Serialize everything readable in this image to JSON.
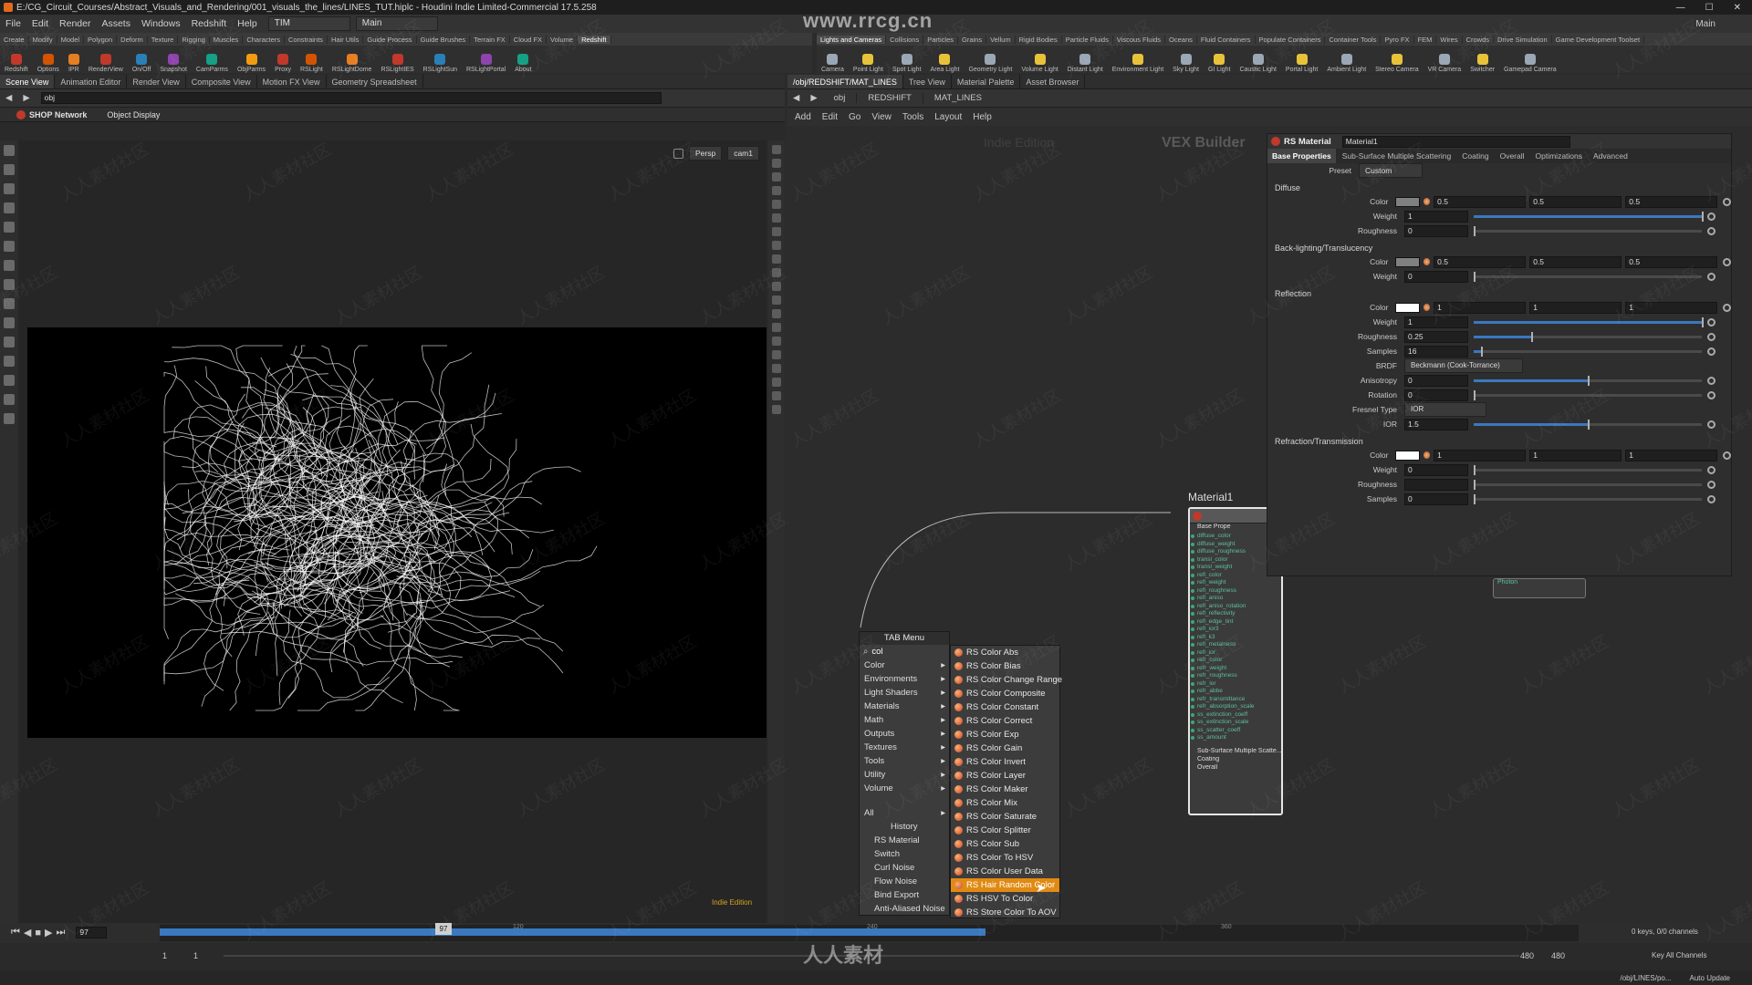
{
  "window": {
    "title": "E:/CG_Circuit_Courses/Abstract_Visuals_and_Rendering/001_visuals_the_lines/LINES_TUT.hiplc - Houdini Indie Limited-Commercial 17.5.258",
    "right_desk": "Main"
  },
  "watermark": {
    "top": "www.rrcg.cn",
    "bottom": "人人素材",
    "tile": "人人素材社区"
  },
  "menubar": {
    "items": [
      "File",
      "Edit",
      "Render",
      "Assets",
      "Windows",
      "Redshift",
      "Help"
    ],
    "desktop": "TIM",
    "main": "Main"
  },
  "left_shelf": {
    "tabs": [
      "Create",
      "Modify",
      "Model",
      "Polygon",
      "Deform",
      "Texture",
      "Rigging",
      "Muscles",
      "Characters",
      "Constraints",
      "Hair Utils",
      "Guide Process",
      "Guide Brushes",
      "Terrain FX",
      "Cloud FX",
      "Volume",
      "Redshift"
    ],
    "active_tab": "Redshift",
    "tools": [
      "Redshift",
      "Options",
      "IPR",
      "RenderView",
      "On/Off",
      "Snapshot",
      "CamParms",
      "ObjParms",
      "Proxy",
      "RSLight",
      "RSLightDome",
      "RSLightIES",
      "RSLightSun",
      "RSLightPortal",
      "About"
    ]
  },
  "right_shelf": {
    "tabs": [
      "Lights and Cameras",
      "Collisions",
      "Particles",
      "Grains",
      "Vellum",
      "Rigid Bodies",
      "Particle Fluids",
      "Viscous Fluids",
      "Oceans",
      "Fluid Containers",
      "Populate Containers",
      "Container Tools",
      "Pyro FX",
      "FEM",
      "Wires",
      "Crowds",
      "Drive Simulation",
      "Game Development Toolset"
    ],
    "active_tab": "Lights and Cameras",
    "tools": [
      "Camera",
      "Point Light",
      "Spot Light",
      "Area Light",
      "Geometry Light",
      "Volume Light",
      "Distant Light",
      "Environment Light",
      "Sky Light",
      "GI Light",
      "Caustic Light",
      "Portal Light",
      "Ambient Light",
      "Stereo Camera",
      "VR Camera",
      "Switcher",
      "Gamepad Camera"
    ]
  },
  "scene_view": {
    "tabs": [
      "Scene View",
      "Animation Editor",
      "Render View",
      "Composite View",
      "Motion FX View",
      "Geometry Spreadsheet"
    ],
    "path": "obj",
    "network_label": "SHOP Network",
    "display_label": "Object Display",
    "persp": "Persp",
    "camera": "cam1",
    "edition": "Indie Edition"
  },
  "network_view": {
    "tabs": [
      "/obj/REDSHIFT/MAT_LINES",
      "Tree View",
      "Material Palette",
      "Asset Browser"
    ],
    "path": [
      "obj",
      "REDSHIFT",
      "MAT_LINES"
    ],
    "menu": [
      "Add",
      "Edit",
      "Go",
      "View",
      "Tools",
      "Layout",
      "Help"
    ],
    "edition": "Indie Edition",
    "context": "VEX Builder",
    "node_name": "Material1",
    "node_section_base": "Base Prope",
    "node_ports": [
      "diffuse_color",
      "diffuse_weight",
      "diffuse_roughness",
      "transl_color",
      "transl_weight",
      "refl_color",
      "refl_weight",
      "refl_roughness",
      "refl_aniso",
      "refl_aniso_rotation",
      "refl_reflectivity",
      "refl_edge_tint",
      "refl_ior3",
      "refl_k3",
      "refl_metalness",
      "refl_ior",
      "refr_color",
      "refr_weight",
      "refr_roughness",
      "refr_ior",
      "refr_abbe",
      "refr_transmittance",
      "refr_absorption_scale",
      "ss_extinction_coeff",
      "ss_extinction_scale",
      "ss_scatter_coeff",
      "ss_amount"
    ],
    "node_sections": [
      "Sub-Surface Multiple Scatte...",
      "Coating",
      "Overall"
    ],
    "other_node_label": "Photon"
  },
  "tab_menu": {
    "title": "TAB Menu",
    "search": "col",
    "categories": [
      "Color",
      "Environments",
      "Light Shaders",
      "Materials",
      "Math",
      "Outputs",
      "Textures",
      "Tools",
      "Utility",
      "Volume"
    ],
    "all": "All",
    "history_label": "History",
    "history": [
      "RS Material",
      "Switch",
      "Curl Noise",
      "Flow Noise",
      "Bind Export",
      "Anti-Aliased Noise"
    ],
    "results": [
      "RS Color Abs",
      "RS Color Bias",
      "RS Color Change Range",
      "RS Color Composite",
      "RS Color Constant",
      "RS Color Correct",
      "RS Color Exp",
      "RS Color Gain",
      "RS Color Invert",
      "RS Color Layer",
      "RS Color Maker",
      "RS Color Mix",
      "RS Color Saturate",
      "RS Color Splitter",
      "RS Color Sub",
      "RS Color To HSV",
      "RS Color User Data",
      "RS Hair Random Color",
      "RS HSV To Color",
      "RS Store Color To AOV"
    ],
    "highlighted": "RS Hair Random Color"
  },
  "params": {
    "type": "RS Material",
    "name": "Material1",
    "tabs": [
      "Base Properties",
      "Sub-Surface Multiple Scattering",
      "Coating",
      "Overall",
      "Optimizations",
      "Advanced"
    ],
    "preset_label": "Preset",
    "preset": "Custom",
    "diffuse": {
      "title": "Diffuse",
      "color_label": "Color",
      "color": [
        "0.5",
        "0.5",
        "0.5"
      ],
      "weight_label": "Weight",
      "weight": "1",
      "roughness_label": "Roughness",
      "roughness": "0"
    },
    "backlight": {
      "title": "Back-lighting/Translucency",
      "color_label": "Color",
      "color": [
        "0.5",
        "0.5",
        "0.5"
      ],
      "weight_label": "Weight",
      "weight": "0"
    },
    "reflection": {
      "title": "Reflection",
      "color_label": "Color",
      "color": [
        "1",
        "1",
        "1"
      ],
      "weight_label": "Weight",
      "weight": "1",
      "roughness_label": "Roughness",
      "roughness": "0.25",
      "samples_label": "Samples",
      "samples": "16",
      "brdf_label": "BRDF",
      "brdf": "Beckmann (Cook-Torrance)",
      "aniso_label": "Anisotropy",
      "aniso": "0",
      "rotation_label": "Rotation",
      "rotation": "0",
      "fresnel_label": "Fresnel Type",
      "fresnel": "IOR",
      "ior_label": "IOR",
      "ior": "1.5"
    },
    "refraction": {
      "title": "Refraction/Transmission",
      "color_label": "Color",
      "color": [
        "1",
        "1",
        "1"
      ],
      "weight_label": "Weight",
      "weight": "0",
      "roughness_label": "Roughness",
      "samples_label": "Samples",
      "samples": "0"
    }
  },
  "timeline": {
    "frame": "97",
    "start": "1",
    "start2": "1",
    "end": "480",
    "end2": "480",
    "ticks": [
      "120",
      "240",
      "360"
    ],
    "keys": "0 keys, 0/0 channels",
    "key_all": "Key All Channels",
    "path": "/obj/LINES/po...",
    "auto_update": "Auto Update"
  },
  "colors": {
    "accent": "#3a78c0",
    "highlight": "#e08a13",
    "node_port": "#5fbf9a"
  }
}
